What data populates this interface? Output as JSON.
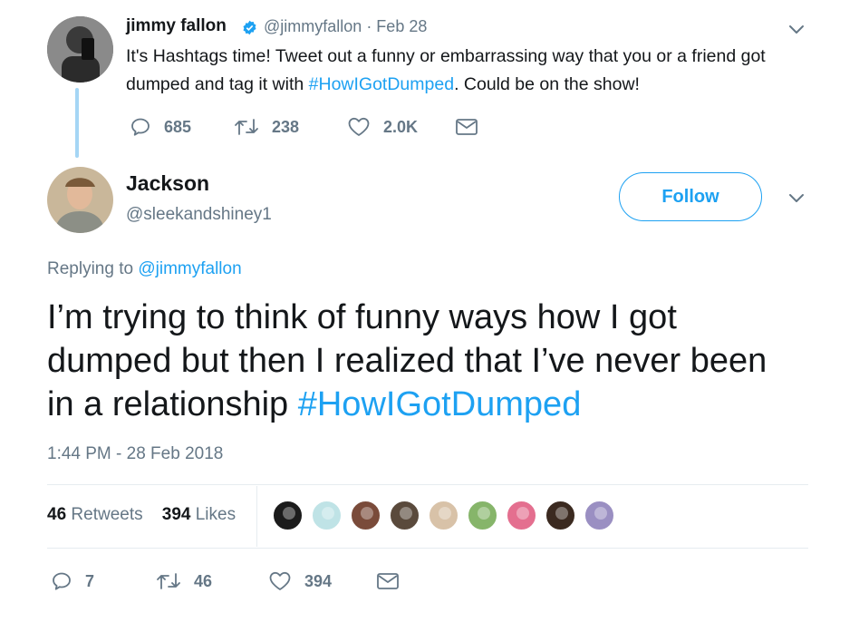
{
  "parent_tweet": {
    "name": "jimmy fallon",
    "handle": "@jimmyfallon",
    "date": "· Feb 28",
    "text_before": "It's Hashtags time! Tweet out a funny or embarrassing way that you or a friend got dumped and tag it with ",
    "hashtag": "#HowIGotDumped",
    "text_after": ". Could be on the show!",
    "actions": {
      "replies": "685",
      "retweets": "238",
      "likes": "2.0K"
    }
  },
  "tweet": {
    "name": "Jackson",
    "handle": "@sleekandshiney1",
    "follow_label": "Follow",
    "replying_prefix": "Replying to ",
    "replying_to": "@jimmyfallon",
    "text_main": "I’m trying to think of funny ways how I got dumped but then I realized that I’ve never been in a relationship ",
    "hashtag": "#HowIGotDumped",
    "timestamp": "1:44 PM - 28 Feb 2018",
    "retweets_count": "46",
    "retweets_label": "Retweets",
    "likes_count": "394",
    "likes_label": "Likes",
    "actions": {
      "replies": "7",
      "retweets": "46",
      "likes": "394"
    }
  },
  "liker_avatars": [
    {
      "icon": "avengers-logo-avatar",
      "color": "#1b1b1b"
    },
    {
      "icon": "fish-tank-avatar",
      "color": "#bfe3e6"
    },
    {
      "icon": "person-avatar",
      "color": "#7a4b3a"
    },
    {
      "icon": "person-avatar",
      "color": "#5a4a3c"
    },
    {
      "icon": "person-avatar",
      "color": "#d8c2a8"
    },
    {
      "icon": "landscape-avatar",
      "color": "#86b56a"
    },
    {
      "icon": "anime-avatar",
      "color": "#e46f8f"
    },
    {
      "icon": "person-avatar",
      "color": "#3b2a20"
    },
    {
      "icon": "person-avatar",
      "color": "#9a8fc2"
    }
  ],
  "colors": {
    "accent": "#1da1f2",
    "muted": "#657786",
    "thread": "#a5d6f5"
  }
}
